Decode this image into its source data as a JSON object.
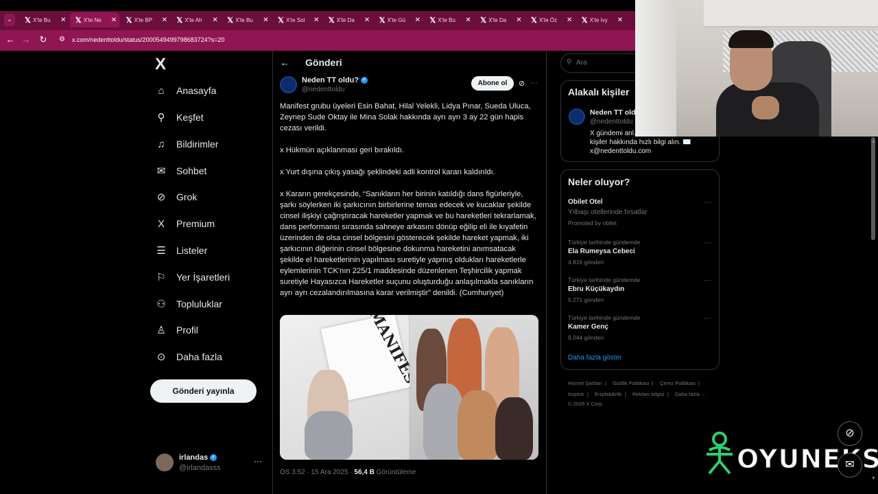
{
  "browser": {
    "tabs": [
      {
        "label": "X'te Bu",
        "active": false
      },
      {
        "label": "X'te Ne",
        "active": true
      },
      {
        "label": "X'te BP",
        "active": false
      },
      {
        "label": "X'te Ah",
        "active": false
      },
      {
        "label": "X'te Bu",
        "active": false
      },
      {
        "label": "X'te Sol",
        "active": false
      },
      {
        "label": "X'te Da",
        "active": false
      },
      {
        "label": "X'te Gü",
        "active": false
      },
      {
        "label": "X'te Bu",
        "active": false
      },
      {
        "label": "X'te Da",
        "active": false
      },
      {
        "label": "X'te Öz",
        "active": false
      },
      {
        "label": "X'te Ivy",
        "active": false
      }
    ],
    "url": "x.com/nedenttoldu/status/2000549499798683724?s=20",
    "accent": "#8f1652"
  },
  "nav": {
    "logo": "X",
    "items": [
      {
        "label": "Anasayfa",
        "icon": "home-icon",
        "glyph": "⌂"
      },
      {
        "label": "Keşfet",
        "icon": "search-icon",
        "glyph": "⚲"
      },
      {
        "label": "Bildirimler",
        "icon": "bell-icon",
        "glyph": "♫"
      },
      {
        "label": "Sohbet",
        "icon": "mail-icon",
        "glyph": "✉"
      },
      {
        "label": "Grok",
        "icon": "grok-icon",
        "glyph": "⊘"
      },
      {
        "label": "Premium",
        "icon": "x-premium-icon",
        "glyph": "X"
      },
      {
        "label": "Listeler",
        "icon": "list-icon",
        "glyph": "☰"
      },
      {
        "label": "Yer İşaretleri",
        "icon": "bookmark-icon",
        "glyph": "⚐"
      },
      {
        "label": "Topluluklar",
        "icon": "communities-icon",
        "glyph": "⚇"
      },
      {
        "label": "Profil",
        "icon": "profile-icon",
        "glyph": "♙"
      },
      {
        "label": "Daha fazla",
        "icon": "more-circle-icon",
        "glyph": "⊙"
      }
    ],
    "post_button": "Gönderi yayınla",
    "me": {
      "name": "irlandas",
      "handle": "@irlandasss"
    }
  },
  "post": {
    "header_title": "Gönderi",
    "author_name": "Neden TT oldu?",
    "author_handle": "@nedenttoldu",
    "subscribe_label": "Abone ol",
    "paragraphs": [
      "Manifest grubu üyeleri Esin Bahat, Hilal Yelekli, Lidya Pınar, Sueda Uluca, Zeynep Sude Oktay ile Mina Solak hakkında ayrı ayrı 3 ay 22 gün hapis cezası verildi.",
      "x Hükmün açıklanması geri bırakıldı.",
      "x Yurt dışına çıkış yasağı şeklindeki adli kontrol kararı kaldırıldı.",
      "x Kararın gerekçesinde, “Sanıkların her birinin katıldığı dans figürleriyle, şarkı söylerken iki şarkıcının birbirlerine temas edecek ve kucaklar şekilde cinsel ilişkiyi çağrıştıracak hareketler yapmak ve bu hareketleri tekrarlamak, dans performansı sırasında sahneye arkasını dönüp eğilip eli ile kıyafetin üzerinden de olsa cinsel bölgesini gösterecek şekilde hareket yapmak, iki şarkıcının diğerinin cinsel bölgesine dokunma hareketini anımsatacak şekilde el hareketlerinin yapılması suretiyle yapmış oldukları hareketlerle eylemlerinin TCK'nın 225/1 maddesinde düzenlenen Teşhircilik yapmak suretiyle Hayasızca Hareketler suçunu oluşturduğu anlaşılmakla sanıkların ayrı ayrı cezalandırılmasına karar verilmiştir” denildi. (Cumhuriyet)"
    ],
    "flag_text": "MANIFEST",
    "time": "ÖS 3:52 · 15 Ara 2025 ·",
    "views_value": "56,4 B",
    "views_label": "Görüntüleme"
  },
  "right": {
    "search_placeholder": "Ara",
    "related_title": "Alakalı kişiler",
    "related": {
      "name": "Neden TT old...",
      "handle": "@nedenttoldu",
      "bio": "X gündemi anl... haberler, konular ve kişiler hakkında hızlı bilgi alın. ✉️ x@nedenttoldu.com"
    },
    "trends_title": "Neler oluyor?",
    "trends": [
      {
        "category": "",
        "title": "Obilet Otel",
        "subtitle": "Yılbaşı otellerinde fırsatlar",
        "count": "Promoted by obilet"
      },
      {
        "category": "Türkiye tarihinde gündemde",
        "title": "Ela Rumeysa Cebeci",
        "subtitle": "",
        "count": "4.816 gönderi"
      },
      {
        "category": "Türkiye tarihinde gündemde",
        "title": "Ebru Küçükaydın",
        "subtitle": "",
        "count": "5.271 gönderi"
      },
      {
        "category": "Türkiye tarihinde gündemde",
        "title": "Kamer Genç",
        "subtitle": "",
        "count": "9.044 gönderi"
      }
    ],
    "show_more": "Daha fazla göster",
    "footer": [
      "Hizmet Şartları",
      "|",
      "Gizlilik Politikası",
      "|",
      "Çerez Politikası",
      "|",
      "Imprint",
      "|",
      "Erişilebilirlik",
      "|",
      "Reklam bilgisi",
      "|",
      "Daha fazla ···",
      "© 2025 X Corp."
    ]
  },
  "watermark": {
    "text": "OYUNEKS",
    "color": "#2ecf6f"
  }
}
